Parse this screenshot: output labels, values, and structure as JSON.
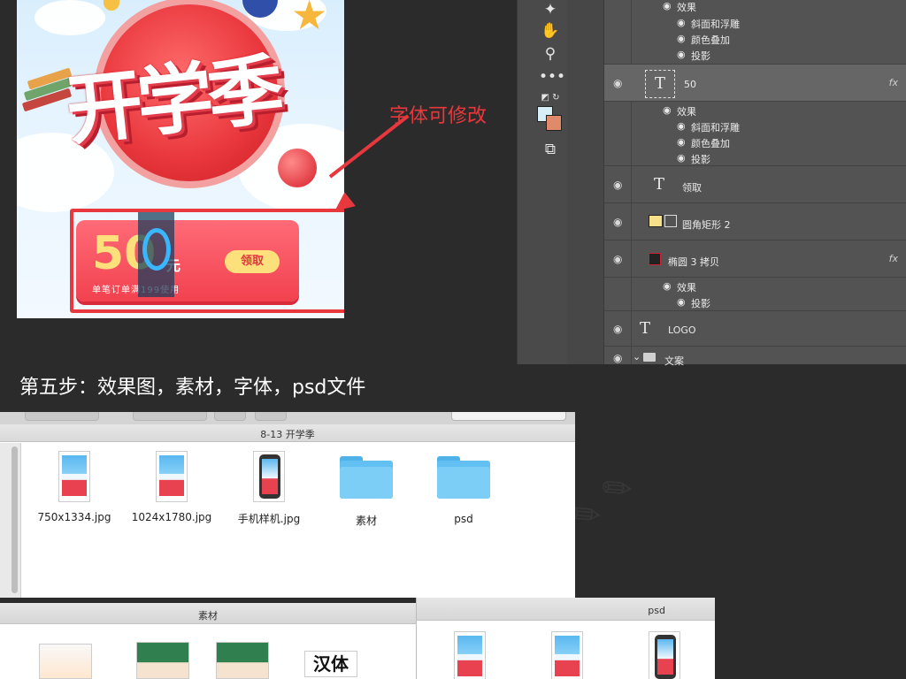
{
  "poster": {
    "title_art": "开学季",
    "coupon_amount": "50",
    "coupon_unit": "元",
    "coupon_rule": "单笔订单满199使用",
    "coupon_button": "领取"
  },
  "annotation": {
    "note": "字体可修改"
  },
  "layers_panel": {
    "rows": [
      {
        "label": "效果",
        "sub": [
          "斜面和浮雕",
          "颜色叠加",
          "投影"
        ]
      },
      {
        "label": "50",
        "fx": "fx",
        "effects_label": "效果",
        "sub": [
          "斜面和浮雕",
          "颜色叠加",
          "投影"
        ]
      },
      {
        "label": "领取"
      },
      {
        "label": "圆角矩形 2"
      },
      {
        "label": "椭圆 3 拷贝",
        "fx": "fx",
        "effects_label": "效果",
        "sub": [
          "投影"
        ]
      },
      {
        "label": "LOGO"
      },
      {
        "label": "文案"
      }
    ],
    "colors": {
      "foreground": "#d8eef7",
      "background": "#e08a6c"
    }
  },
  "step": {
    "caption": "第五步：效果图，素材，字体，psd文件"
  },
  "finder_main": {
    "title": "8-13 开学季",
    "items": [
      {
        "name": "750x1334.jpg",
        "kind": "image"
      },
      {
        "name": "1024x1780.jpg",
        "kind": "image"
      },
      {
        "name": "手机样机.jpg",
        "kind": "phone"
      },
      {
        "name": "素材",
        "kind": "folder"
      },
      {
        "name": "psd",
        "kind": "folder"
      }
    ]
  },
  "finder_sucai": {
    "title": "素材",
    "font_sample": "汉体"
  },
  "finder_psd": {
    "title": "psd"
  }
}
